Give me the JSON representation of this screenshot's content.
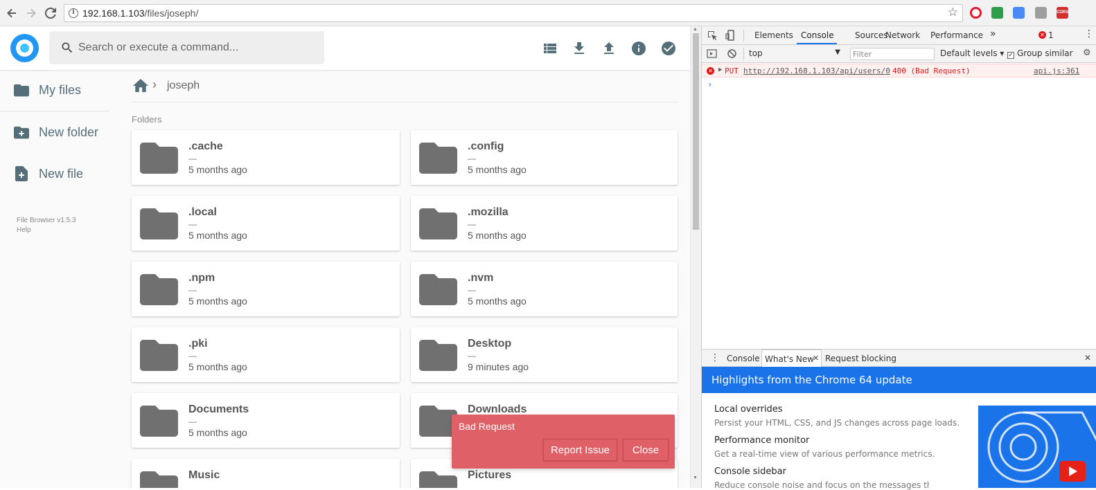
{
  "browser": {
    "url_host": "192.168.1.103",
    "url_path": "/files/joseph/",
    "extensions": [
      "opera-icon",
      "green-extension-icon",
      "translate-icon",
      "gray-extension-icon",
      "cors-icon"
    ],
    "cors_label": "CORS"
  },
  "app": {
    "search_placeholder": "Search or execute a command...",
    "sidebar": {
      "items": [
        {
          "label": "My files",
          "icon": "folder-icon"
        },
        {
          "label": "New folder",
          "icon": "new-folder-icon"
        },
        {
          "label": "New file",
          "icon": "new-file-icon"
        }
      ],
      "version": "File Browser v1.5.3",
      "help": "Help"
    },
    "header_actions": [
      "list-view-icon",
      "download-icon",
      "upload-icon",
      "info-icon",
      "select-check-icon"
    ],
    "breadcrumb": {
      "current": "joseph",
      "separator": "›"
    },
    "folders_label": "Folders",
    "folders": [
      {
        "name": ".cache",
        "size": "—",
        "modified": "5 months ago"
      },
      {
        "name": ".config",
        "size": "—",
        "modified": "5 months ago"
      },
      {
        "name": ".local",
        "size": "—",
        "modified": "5 months ago"
      },
      {
        "name": ".mozilla",
        "size": "—",
        "modified": "5 months ago"
      },
      {
        "name": ".npm",
        "size": "—",
        "modified": "5 months ago"
      },
      {
        "name": ".nvm",
        "size": "—",
        "modified": "5 months ago"
      },
      {
        "name": ".pki",
        "size": "—",
        "modified": "5 months ago"
      },
      {
        "name": "Desktop",
        "size": "—",
        "modified": "9 minutes ago"
      },
      {
        "name": "Documents",
        "size": "—",
        "modified": "5 months ago"
      },
      {
        "name": "Downloads",
        "size": "",
        "modified": ""
      },
      {
        "name": "Music",
        "size": "",
        "modified": ""
      },
      {
        "name": "Pictures",
        "size": "",
        "modified": ""
      }
    ],
    "toast": {
      "message": "Bad Request",
      "report_label": "Report Issue",
      "close_label": "Close",
      "color": "#e06067"
    }
  },
  "devtools": {
    "tabs": [
      "Elements",
      "Console",
      "Sources",
      "Network",
      "Performance"
    ],
    "more_tabs": "»",
    "error_count": "1",
    "context": "top",
    "filter_placeholder": "Filter",
    "levels": "Default levels ▾",
    "group_similar": "Group similar",
    "error": {
      "method": "PUT",
      "url": "http://192.168.1.103/api/users/0",
      "status": "400 (Bad Request)",
      "source": "api.js:361"
    },
    "prompt": "›",
    "drawer_tabs": [
      "Console",
      "What's New",
      "Request blocking"
    ],
    "banner": "Highlights from the Chrome 64 update",
    "whats_new": [
      {
        "title": "Local overrides",
        "desc": "Persist your HTML, CSS, and JS changes across page loads."
      },
      {
        "title": "Performance monitor",
        "desc": "Get a real-time view of various performance metrics."
      },
      {
        "title": "Console sidebar",
        "desc": "Reduce console noise and focus on the messages that are"
      }
    ]
  }
}
